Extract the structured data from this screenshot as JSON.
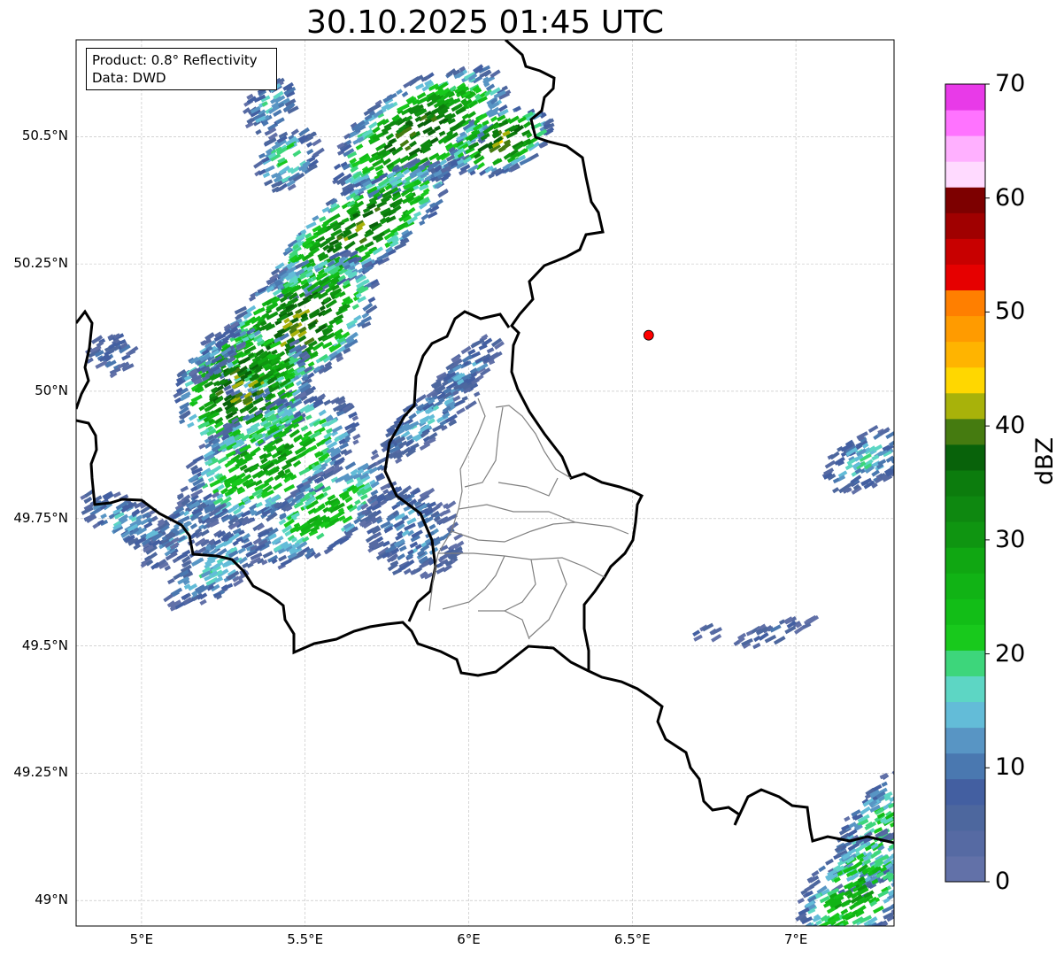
{
  "title": "30.10.2025 01:45 UTC",
  "infobox": {
    "product": "Product: 0.8° Reflectivity",
    "data": "Data: DWD"
  },
  "map": {
    "lon_range": [
      4.8,
      7.3
    ],
    "lat_range": [
      48.95,
      50.69
    ],
    "lat_ticks": [
      {
        "value": 50.5,
        "label": "50.5°N"
      },
      {
        "value": 50.25,
        "label": "50.25°N"
      },
      {
        "value": 50.0,
        "label": "50°N"
      },
      {
        "value": 49.75,
        "label": "49.75°N"
      },
      {
        "value": 49.5,
        "label": "49.5°N"
      },
      {
        "value": 49.25,
        "label": "49.25°N"
      },
      {
        "value": 49.0,
        "label": "49°N"
      }
    ],
    "lon_ticks": [
      {
        "value": 5.0,
        "label": "5°E"
      },
      {
        "value": 5.5,
        "label": "5.5°E"
      },
      {
        "value": 6.0,
        "label": "6°E"
      },
      {
        "value": 6.5,
        "label": "6.5°E"
      },
      {
        "value": 7.0,
        "label": "7°E"
      }
    ],
    "radar_site": {
      "lon": 6.55,
      "lat": 50.11,
      "color": "#ff0000"
    },
    "grid_color": "#bbbbbb"
  },
  "colorbar": {
    "label": "dBZ",
    "range": [
      0,
      70
    ],
    "tick_labels": [
      {
        "value": 0,
        "label": "0"
      },
      {
        "value": 10,
        "label": "10"
      },
      {
        "value": 20,
        "label": "20"
      },
      {
        "value": 30,
        "label": "30"
      },
      {
        "value": 40,
        "label": "40"
      },
      {
        "value": 50,
        "label": "50"
      },
      {
        "value": 60,
        "label": "60"
      },
      {
        "value": 70,
        "label": "70"
      }
    ],
    "colors": [
      "#6271a8",
      "#566aa3",
      "#4d679e",
      "#435fa1",
      "#4a78b0",
      "#5895c4",
      "#63bcd8",
      "#5dd6c4",
      "#3dd67b",
      "#18c91c",
      "#12be17",
      "#11b315",
      "#10a712",
      "#0f9511",
      "#0e8810",
      "#0c7c0d",
      "#08620a",
      "#457b10",
      "#a8b20a",
      "#ffd700",
      "#ffb400",
      "#ff9b00",
      "#ff7f00",
      "#e60000",
      "#c80000",
      "#a00000",
      "#7d0000",
      "#ffdaff",
      "#ffb0ff",
      "#ff73ff",
      "#e83ae8"
    ]
  },
  "colors": {
    "border": "#000000",
    "admin_border": "#808080",
    "frame": "#000000"
  }
}
